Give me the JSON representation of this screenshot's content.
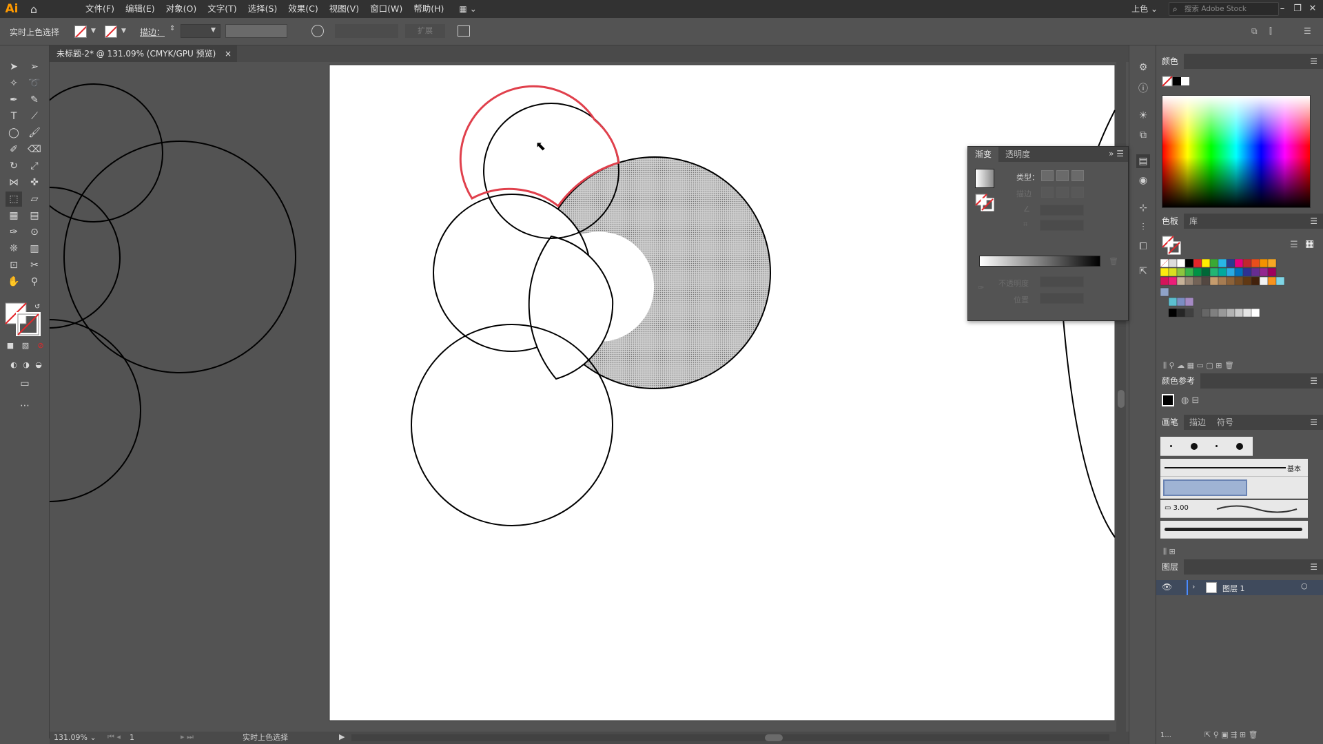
{
  "app": {
    "logo": "Ai",
    "home_icon": "home-icon"
  },
  "menu": [
    "文件(F)",
    "编辑(E)",
    "对象(O)",
    "文字(T)",
    "选择(S)",
    "效果(C)",
    "视图(V)",
    "窗口(W)",
    "帮助(H)"
  ],
  "workspace": "上色",
  "stock_search": {
    "placeholder": "搜索 Adobe Stock"
  },
  "control_bar": {
    "tool_label": "实时上色选择",
    "stroke_label": "描边：",
    "expand_label": "扩展"
  },
  "document": {
    "tab_title": "未标题-2* @ 131.09% (CMYK/GPU 预览)",
    "close": "×"
  },
  "status": {
    "zoom": "131.09%",
    "page": "1",
    "text": "实时上色选择"
  },
  "gradient_panel": {
    "tabs": [
      "渐变",
      "透明度"
    ],
    "type_label": "类型：",
    "stroke_label": "描边",
    "opacity_label": "不透明度",
    "location_label": "位置"
  },
  "panels": {
    "color": {
      "title": "颜色"
    },
    "swatches": {
      "tabs": [
        "色板",
        "库"
      ]
    },
    "color_guide": {
      "title": "颜色参考"
    },
    "brushes": {
      "tabs": [
        "画笔",
        "描边",
        "符号"
      ],
      "basic_label": "基本",
      "size_label": "3.00"
    },
    "layers": {
      "title": "图层",
      "layer_name": "图层 1"
    },
    "layers_count": "1..."
  },
  "colors": {
    "accent_red": "#e3262a",
    "selection_red": "#e0404c",
    "artboard": "#ffffff",
    "pasteboard": "#535353"
  }
}
